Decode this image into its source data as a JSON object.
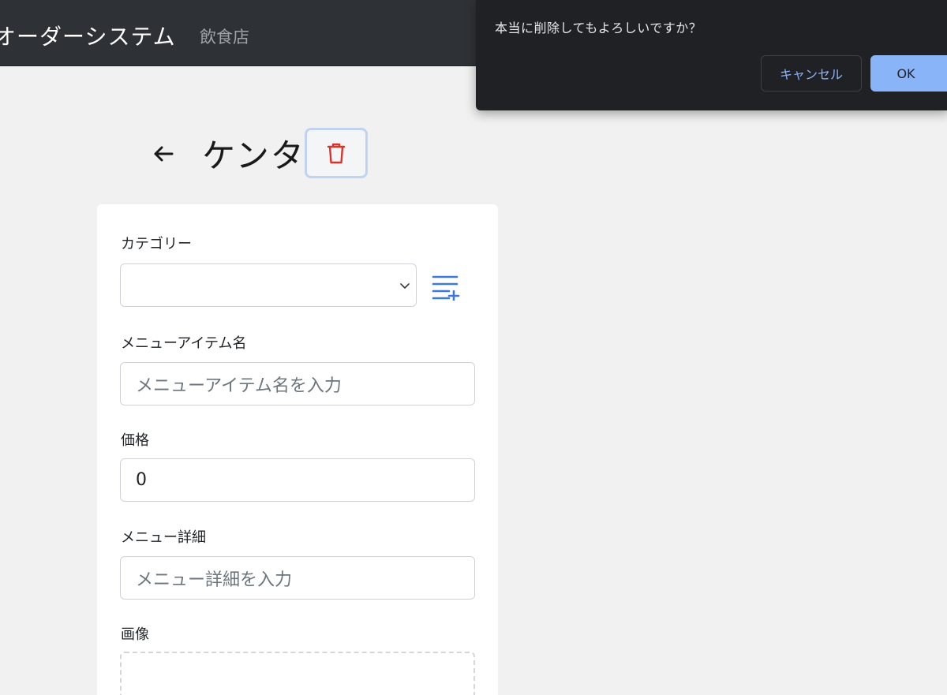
{
  "navbar": {
    "brand": "オーダーシステム",
    "subtitle": "飲食店"
  },
  "header": {
    "back_icon": "arrow-left-icon",
    "title": "ケンタ",
    "delete_icon": "trash-icon"
  },
  "form": {
    "category": {
      "label": "カテゴリー",
      "value": "",
      "chevron_icon": "chevron-down-icon",
      "add_icon": "playlist-add-icon"
    },
    "item_name": {
      "label": "メニューアイテム名",
      "placeholder": "メニューアイテム名を入力"
    },
    "price": {
      "label": "価格",
      "value": "0"
    },
    "description": {
      "label": "メニュー詳細",
      "placeholder": "メニュー詳細を入力"
    },
    "image": {
      "label": "画像"
    }
  },
  "dialog": {
    "message": "本当に削除してもよろしいですか？",
    "cancel_label": "キャンセル",
    "ok_label": "OK"
  },
  "colors": {
    "navbar_bg": "#2e3236",
    "page_bg": "#f1f1f1",
    "danger": "#d9342b",
    "accent": "#3d7ad6",
    "dialog_bg": "#202124",
    "dialog_accent": "#8ab4f8"
  }
}
